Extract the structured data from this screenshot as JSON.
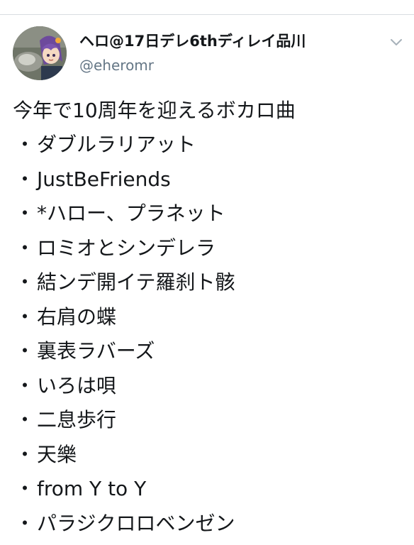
{
  "tweet": {
    "display_name": "ヘロ@17日デレ6thディレイ品川",
    "handle": "@eheromr",
    "intro": "今年で10周年を迎えるボカロ曲",
    "bullet": "・",
    "songs": [
      "ダブルラリアット",
      "JustBeFriends",
      "*ハロー、プラネット",
      "ロミオとシンデレラ",
      "結ンデ開イテ羅刹ト骸",
      "右肩の蝶",
      "裏表ラバーズ",
      "いろは唄",
      "二息歩行",
      "天樂",
      "from Y to Y",
      "パラジクロロベンゼン"
    ]
  },
  "icons": {
    "avatar": "avatar-image",
    "caret": "chevron-down-icon"
  },
  "colors": {
    "text": "#14171a",
    "secondary": "#657786",
    "divider": "#d9dde1"
  }
}
